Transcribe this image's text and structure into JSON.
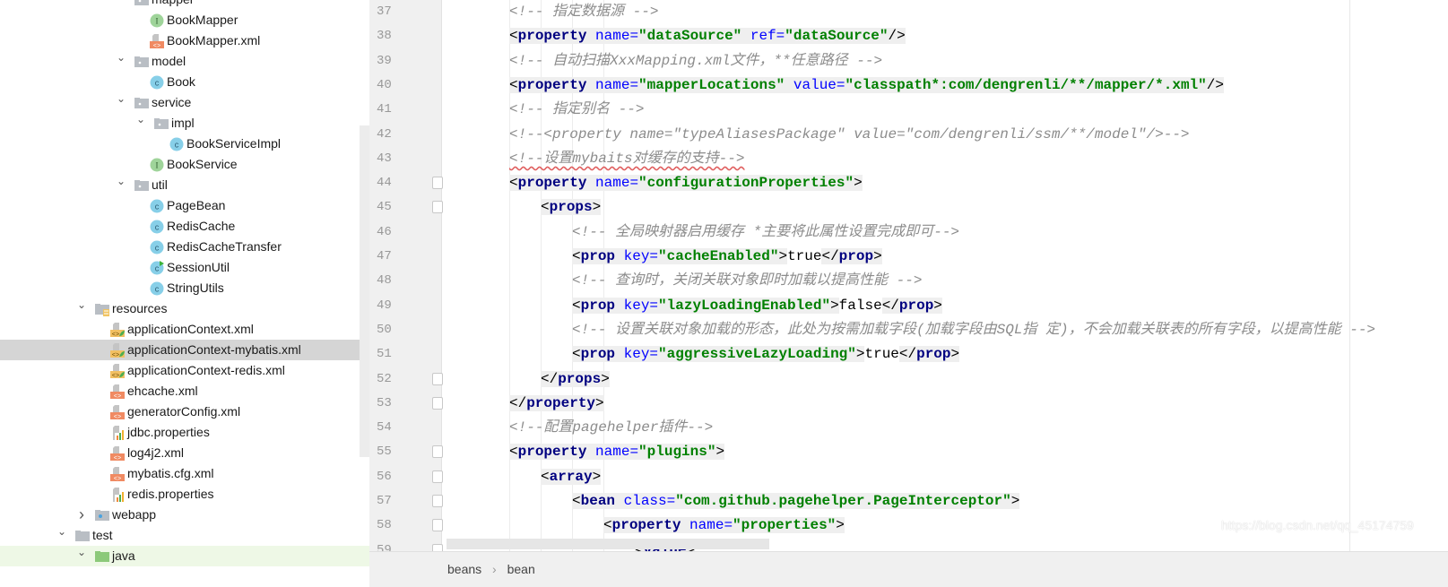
{
  "project_tree": {
    "items": [
      {
        "label": "mapper",
        "level": 3,
        "icon": "folder-icon",
        "chevron": "down"
      },
      {
        "label": "BookMapper",
        "level": 4,
        "icon": "interface-icon"
      },
      {
        "label": "BookMapper.xml",
        "level": 4,
        "icon": "xml-file-icon"
      },
      {
        "label": "model",
        "level": 3,
        "icon": "folder-icon",
        "chevron": "down"
      },
      {
        "label": "Book",
        "level": 4,
        "icon": "class-icon"
      },
      {
        "label": "service",
        "level": 3,
        "icon": "folder-icon",
        "chevron": "down"
      },
      {
        "label": "impl",
        "level": 4,
        "icon": "folder-icon",
        "chevron": "down"
      },
      {
        "label": "BookServiceImpl",
        "level": 5,
        "icon": "class-icon"
      },
      {
        "label": "BookService",
        "level": 4,
        "icon": "interface-icon"
      },
      {
        "label": "util",
        "level": 3,
        "icon": "folder-icon",
        "chevron": "down"
      },
      {
        "label": "PageBean",
        "level": 4,
        "icon": "class-icon"
      },
      {
        "label": "RedisCache",
        "level": 4,
        "icon": "class-icon"
      },
      {
        "label": "RedisCacheTransfer",
        "level": 4,
        "icon": "class-icon"
      },
      {
        "label": "SessionUtil",
        "level": 4,
        "icon": "runnable-class-icon"
      },
      {
        "label": "StringUtils",
        "level": 4,
        "icon": "class-icon"
      },
      {
        "label": "resources",
        "level": 1,
        "icon": "resources-folder-icon",
        "chevron": "down"
      },
      {
        "label": "applicationContext.xml",
        "level": 2,
        "icon": "spring-xml-icon"
      },
      {
        "label": "applicationContext-mybatis.xml",
        "level": 2,
        "icon": "spring-xml-icon",
        "selected": true
      },
      {
        "label": "applicationContext-redis.xml",
        "level": 2,
        "icon": "spring-xml-icon"
      },
      {
        "label": "ehcache.xml",
        "level": 2,
        "icon": "xml-file-icon"
      },
      {
        "label": "generatorConfig.xml",
        "level": 2,
        "icon": "xml-file-icon"
      },
      {
        "label": "jdbc.properties",
        "level": 2,
        "icon": "properties-file-icon"
      },
      {
        "label": "log4j2.xml",
        "level": 2,
        "icon": "xml-file-icon"
      },
      {
        "label": "mybatis.cfg.xml",
        "level": 2,
        "icon": "xml-file-icon"
      },
      {
        "label": "redis.properties",
        "level": 2,
        "icon": "properties-file-icon"
      },
      {
        "label": "webapp",
        "level": 1,
        "icon": "web-folder-icon",
        "chevron": "right"
      },
      {
        "label": "test",
        "level": 0,
        "icon": "plain-folder-icon",
        "chevron": "down"
      },
      {
        "label": "java",
        "level": 1,
        "icon": "test-source-folder-icon",
        "chevron": "down",
        "highlight": "green"
      }
    ]
  },
  "editor": {
    "lines": [
      {
        "n": "37",
        "indent": 0,
        "tokens": [
          [
            "c",
            "<!-- 指定数据源 -->"
          ]
        ]
      },
      {
        "n": "38",
        "indent": 0,
        "tokens": [
          [
            "b",
            "<"
          ],
          [
            "t",
            "property"
          ],
          [
            "x",
            " "
          ],
          [
            "a",
            "name="
          ],
          [
            "v",
            "\"dataSource\""
          ],
          [
            "x",
            " "
          ],
          [
            "a",
            "ref="
          ],
          [
            "v",
            "\"dataSource\""
          ],
          [
            "b",
            "/>"
          ]
        ],
        "hl": true
      },
      {
        "n": "39",
        "indent": 0,
        "tokens": [
          [
            "c",
            "<!-- 自动扫描XxxMapping.xml文件，**任意路径 -->"
          ]
        ]
      },
      {
        "n": "40",
        "indent": 0,
        "tokens": [
          [
            "b",
            "<"
          ],
          [
            "t",
            "property"
          ],
          [
            "x",
            " "
          ],
          [
            "a",
            "name="
          ],
          [
            "v",
            "\"mapperLocations\""
          ],
          [
            "x",
            " "
          ],
          [
            "a",
            "value="
          ],
          [
            "v",
            "\"classpath*:com/dengrenli/**/mapper/*.xml\""
          ],
          [
            "b",
            "/>"
          ]
        ],
        "hl": true
      },
      {
        "n": "41",
        "indent": 0,
        "tokens": [
          [
            "c",
            "<!-- 指定别名 -->"
          ]
        ]
      },
      {
        "n": "42",
        "indent": 0,
        "tokens": [
          [
            "c",
            "<!--<property name=\"typeAliasesPackage\" value=\"com/dengrenli/ssm/**/model\"/>-->"
          ]
        ]
      },
      {
        "n": "43",
        "indent": 0,
        "tokens": [
          [
            "c",
            "<!--设置mybaits对缓存的支持-->"
          ]
        ],
        "squiggle": true
      },
      {
        "n": "44",
        "indent": 0,
        "tokens": [
          [
            "b",
            "<"
          ],
          [
            "t",
            "property"
          ],
          [
            "x",
            " "
          ],
          [
            "a",
            "name="
          ],
          [
            "v",
            "\"configurationProperties\""
          ],
          [
            "b",
            ">"
          ]
        ],
        "hl": true,
        "fold": true
      },
      {
        "n": "45",
        "indent": 1,
        "tokens": [
          [
            "b",
            "<"
          ],
          [
            "t",
            "props"
          ],
          [
            "b",
            ">"
          ]
        ],
        "hl": true,
        "fold": true
      },
      {
        "n": "46",
        "indent": 2,
        "tokens": [
          [
            "c",
            "<!-- 全局映射器启用缓存 *主要将此属性设置完成即可-->"
          ]
        ]
      },
      {
        "n": "47",
        "indent": 2,
        "tokens": [
          [
            "b",
            "<"
          ],
          [
            "t",
            "prop"
          ],
          [
            "x",
            " "
          ],
          [
            "a",
            "key="
          ],
          [
            "v",
            "\"cacheEnabled\""
          ],
          [
            "b",
            ">"
          ],
          [
            "x",
            "true"
          ],
          [
            "b",
            "</"
          ],
          [
            "t",
            "prop"
          ],
          [
            "b",
            ">"
          ]
        ],
        "hl": true
      },
      {
        "n": "48",
        "indent": 2,
        "tokens": [
          [
            "c",
            "<!-- 查询时，关闭关联对象即时加载以提高性能 -->"
          ]
        ]
      },
      {
        "n": "49",
        "indent": 2,
        "tokens": [
          [
            "b",
            "<"
          ],
          [
            "t",
            "prop"
          ],
          [
            "x",
            " "
          ],
          [
            "a",
            "key="
          ],
          [
            "v",
            "\"lazyLoadingEnabled\""
          ],
          [
            "b",
            ">"
          ],
          [
            "x",
            "false"
          ],
          [
            "b",
            "</"
          ],
          [
            "t",
            "prop"
          ],
          [
            "b",
            ">"
          ]
        ],
        "hl": true
      },
      {
        "n": "50",
        "indent": 2,
        "tokens": [
          [
            "c",
            "<!-- 设置关联对象加载的形态，此处为按需加载字段(加载字段由SQL指 定)，不会加载关联表的所有字段，以提高性能 -->"
          ]
        ]
      },
      {
        "n": "51",
        "indent": 2,
        "tokens": [
          [
            "b",
            "<"
          ],
          [
            "t",
            "prop"
          ],
          [
            "x",
            " "
          ],
          [
            "a",
            "key="
          ],
          [
            "v",
            "\"aggressiveLazyLoading\""
          ],
          [
            "b",
            ">"
          ],
          [
            "x",
            "true"
          ],
          [
            "b",
            "</"
          ],
          [
            "t",
            "prop"
          ],
          [
            "b",
            ">"
          ]
        ],
        "hl": true
      },
      {
        "n": "52",
        "indent": 1,
        "tokens": [
          [
            "b",
            "</"
          ],
          [
            "t",
            "props"
          ],
          [
            "b",
            ">"
          ]
        ],
        "hl": true,
        "fold": true
      },
      {
        "n": "53",
        "indent": 0,
        "tokens": [
          [
            "b",
            "</"
          ],
          [
            "t",
            "property"
          ],
          [
            "b",
            ">"
          ]
        ],
        "hl": true,
        "fold": true
      },
      {
        "n": "54",
        "indent": 0,
        "tokens": [
          [
            "c",
            "<!--配置pagehelper插件-->"
          ]
        ]
      },
      {
        "n": "55",
        "indent": 0,
        "tokens": [
          [
            "b",
            "<"
          ],
          [
            "t",
            "property"
          ],
          [
            "x",
            " "
          ],
          [
            "a",
            "name="
          ],
          [
            "v",
            "\"plugins\""
          ],
          [
            "b",
            ">"
          ]
        ],
        "hl": true,
        "fold": true
      },
      {
        "n": "56",
        "indent": 1,
        "tokens": [
          [
            "b",
            "<"
          ],
          [
            "t",
            "array"
          ],
          [
            "b",
            ">"
          ]
        ],
        "hl": true,
        "fold": true
      },
      {
        "n": "57",
        "indent": 2,
        "tokens": [
          [
            "b",
            "<"
          ],
          [
            "t",
            "bean"
          ],
          [
            "x",
            " "
          ],
          [
            "a",
            "class="
          ],
          [
            "v",
            "\"com.github.pagehelper.PageInterceptor\""
          ],
          [
            "b",
            ">"
          ]
        ],
        "hl": true,
        "fold": true
      },
      {
        "n": "58",
        "indent": 3,
        "tokens": [
          [
            "b",
            "<"
          ],
          [
            "t",
            "property"
          ],
          [
            "x",
            " "
          ],
          [
            "a",
            "name="
          ],
          [
            "v",
            "\"properties\""
          ],
          [
            "b",
            ">"
          ]
        ],
        "hl": true,
        "fold": true
      },
      {
        "n": "59",
        "indent": 4,
        "tokens": [
          [
            "b",
            "<"
          ],
          [
            "t",
            "value"
          ],
          [
            "b",
            ">"
          ]
        ],
        "hl": true,
        "fold": true
      }
    ]
  },
  "breadcrumb": {
    "items": [
      "beans",
      "bean"
    ],
    "separator": "›"
  },
  "watermark": "https://blog.csdn.net/qq_45174759",
  "colors": {
    "tag": "#000080",
    "attribute": "#0000ff",
    "value": "#008000",
    "comment": "#8c8c8c",
    "selection": "#d5d5d5"
  }
}
